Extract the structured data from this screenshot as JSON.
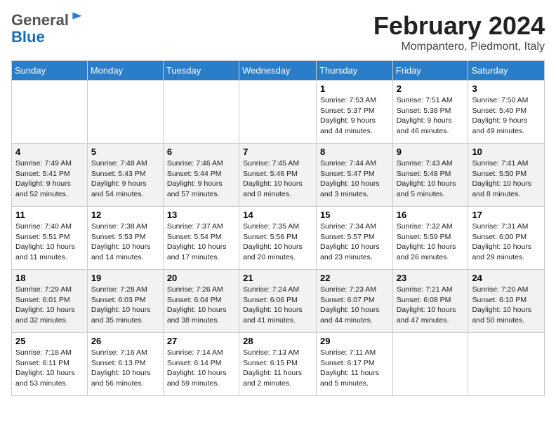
{
  "header": {
    "logo_line1": "General",
    "logo_line2": "Blue",
    "calendar_title": "February 2024",
    "calendar_subtitle": "Mompantero, Piedmont, Italy"
  },
  "days_of_week": [
    "Sunday",
    "Monday",
    "Tuesday",
    "Wednesday",
    "Thursday",
    "Friday",
    "Saturday"
  ],
  "weeks": [
    [
      {
        "day": "",
        "info": ""
      },
      {
        "day": "",
        "info": ""
      },
      {
        "day": "",
        "info": ""
      },
      {
        "day": "",
        "info": ""
      },
      {
        "day": "1",
        "info": "Sunrise: 7:53 AM\nSunset: 5:37 PM\nDaylight: 9 hours\nand 44 minutes."
      },
      {
        "day": "2",
        "info": "Sunrise: 7:51 AM\nSunset: 5:38 PM\nDaylight: 9 hours\nand 46 minutes."
      },
      {
        "day": "3",
        "info": "Sunrise: 7:50 AM\nSunset: 5:40 PM\nDaylight: 9 hours\nand 49 minutes."
      }
    ],
    [
      {
        "day": "4",
        "info": "Sunrise: 7:49 AM\nSunset: 5:41 PM\nDaylight: 9 hours\nand 52 minutes."
      },
      {
        "day": "5",
        "info": "Sunrise: 7:48 AM\nSunset: 5:43 PM\nDaylight: 9 hours\nand 54 minutes."
      },
      {
        "day": "6",
        "info": "Sunrise: 7:46 AM\nSunset: 5:44 PM\nDaylight: 9 hours\nand 57 minutes."
      },
      {
        "day": "7",
        "info": "Sunrise: 7:45 AM\nSunset: 5:46 PM\nDaylight: 10 hours\nand 0 minutes."
      },
      {
        "day": "8",
        "info": "Sunrise: 7:44 AM\nSunset: 5:47 PM\nDaylight: 10 hours\nand 3 minutes."
      },
      {
        "day": "9",
        "info": "Sunrise: 7:43 AM\nSunset: 5:48 PM\nDaylight: 10 hours\nand 5 minutes."
      },
      {
        "day": "10",
        "info": "Sunrise: 7:41 AM\nSunset: 5:50 PM\nDaylight: 10 hours\nand 8 minutes."
      }
    ],
    [
      {
        "day": "11",
        "info": "Sunrise: 7:40 AM\nSunset: 5:51 PM\nDaylight: 10 hours\nand 11 minutes."
      },
      {
        "day": "12",
        "info": "Sunrise: 7:38 AM\nSunset: 5:53 PM\nDaylight: 10 hours\nand 14 minutes."
      },
      {
        "day": "13",
        "info": "Sunrise: 7:37 AM\nSunset: 5:54 PM\nDaylight: 10 hours\nand 17 minutes."
      },
      {
        "day": "14",
        "info": "Sunrise: 7:35 AM\nSunset: 5:56 PM\nDaylight: 10 hours\nand 20 minutes."
      },
      {
        "day": "15",
        "info": "Sunrise: 7:34 AM\nSunset: 5:57 PM\nDaylight: 10 hours\nand 23 minutes."
      },
      {
        "day": "16",
        "info": "Sunrise: 7:32 AM\nSunset: 5:59 PM\nDaylight: 10 hours\nand 26 minutes."
      },
      {
        "day": "17",
        "info": "Sunrise: 7:31 AM\nSunset: 6:00 PM\nDaylight: 10 hours\nand 29 minutes."
      }
    ],
    [
      {
        "day": "18",
        "info": "Sunrise: 7:29 AM\nSunset: 6:01 PM\nDaylight: 10 hours\nand 32 minutes."
      },
      {
        "day": "19",
        "info": "Sunrise: 7:28 AM\nSunset: 6:03 PM\nDaylight: 10 hours\nand 35 minutes."
      },
      {
        "day": "20",
        "info": "Sunrise: 7:26 AM\nSunset: 6:04 PM\nDaylight: 10 hours\nand 38 minutes."
      },
      {
        "day": "21",
        "info": "Sunrise: 7:24 AM\nSunset: 6:06 PM\nDaylight: 10 hours\nand 41 minutes."
      },
      {
        "day": "22",
        "info": "Sunrise: 7:23 AM\nSunset: 6:07 PM\nDaylight: 10 hours\nand 44 minutes."
      },
      {
        "day": "23",
        "info": "Sunrise: 7:21 AM\nSunset: 6:08 PM\nDaylight: 10 hours\nand 47 minutes."
      },
      {
        "day": "24",
        "info": "Sunrise: 7:20 AM\nSunset: 6:10 PM\nDaylight: 10 hours\nand 50 minutes."
      }
    ],
    [
      {
        "day": "25",
        "info": "Sunrise: 7:18 AM\nSunset: 6:11 PM\nDaylight: 10 hours\nand 53 minutes."
      },
      {
        "day": "26",
        "info": "Sunrise: 7:16 AM\nSunset: 6:13 PM\nDaylight: 10 hours\nand 56 minutes."
      },
      {
        "day": "27",
        "info": "Sunrise: 7:14 AM\nSunset: 6:14 PM\nDaylight: 10 hours\nand 59 minutes."
      },
      {
        "day": "28",
        "info": "Sunrise: 7:13 AM\nSunset: 6:15 PM\nDaylight: 11 hours\nand 2 minutes."
      },
      {
        "day": "29",
        "info": "Sunrise: 7:11 AM\nSunset: 6:17 PM\nDaylight: 11 hours\nand 5 minutes."
      },
      {
        "day": "",
        "info": ""
      },
      {
        "day": "",
        "info": ""
      }
    ]
  ]
}
